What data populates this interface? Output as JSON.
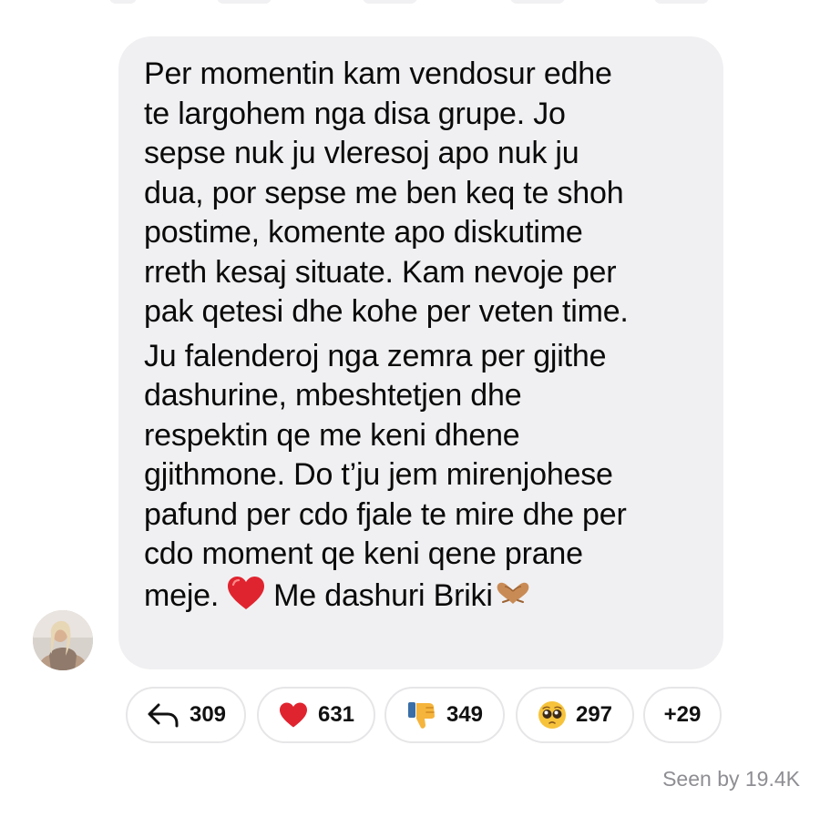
{
  "message": {
    "paragraph1": [
      "Per momentin kam vendosur edhe",
      "te largohem nga disa grupe. Jo",
      "sepse nuk ju vleresoj apo nuk ju",
      "dua, por sepse me ben keq te shoh",
      "postime, komente apo diskutime",
      "rreth kesaj situate. Kam nevoje per",
      "pak qetesi dhe kohe per veten time."
    ],
    "paragraph2": [
      "Ju falenderoj nga zemra per gjithe",
      "dashurine, mbeshtetjen dhe",
      "respektin qe me keni dhene",
      "gjithmone. Do t’ju jem mirenjohese",
      "pafund per cdo fjale te mire dhe per",
      "cdo moment qe keni qene prane"
    ],
    "last_line_start": "meje.",
    "last_line_end": "Me dashuri Briki",
    "emojis": [
      "heart-emoji",
      "heart-hands-emoji"
    ]
  },
  "reactions": [
    {
      "icon": "reply-arrow-icon",
      "count": "309"
    },
    {
      "icon": "red-heart-icon",
      "count": "631"
    },
    {
      "icon": "thumbs-down-icon",
      "count": "349"
    },
    {
      "icon": "pleading-face-icon",
      "count": "297"
    },
    {
      "icon": "",
      "count": "+29"
    }
  ],
  "seen": "Seen by 19.4K",
  "colors": {
    "bubble": "#f0f0f2",
    "heart": "#e0242f",
    "seen_text": "#8e8e93",
    "pill_border": "#e6e6e8"
  }
}
